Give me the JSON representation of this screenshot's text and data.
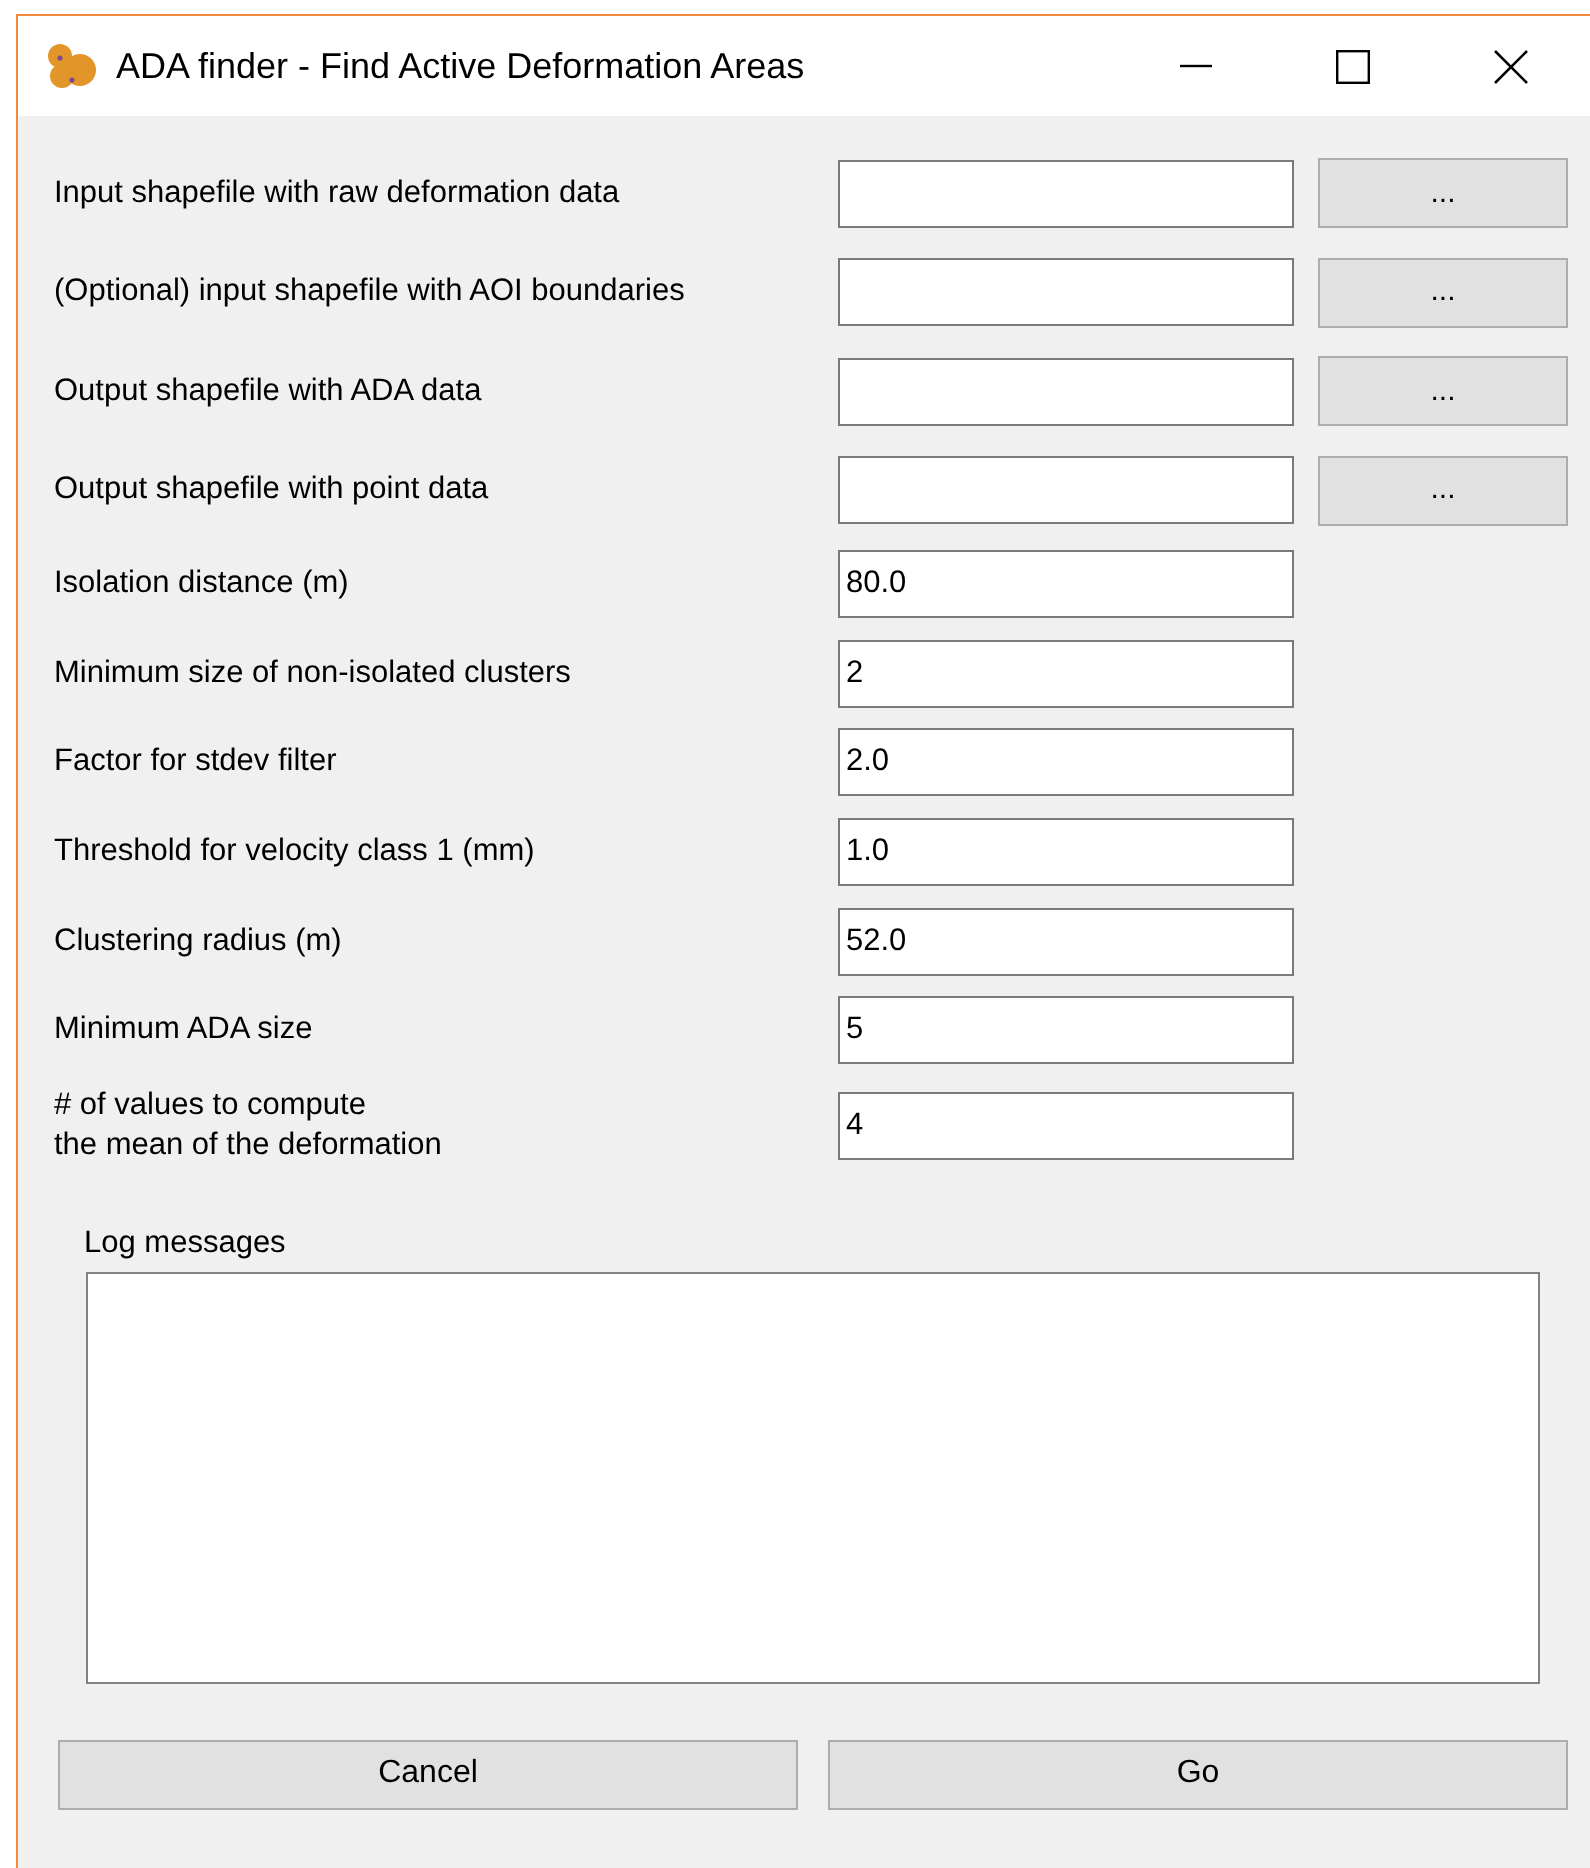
{
  "window": {
    "title": "ADA finder - Find Active Deformation Areas"
  },
  "fields": [
    {
      "kind": "file",
      "label": "Input shapefile with raw deformation data",
      "button": "..."
    },
    {
      "kind": "file",
      "label": "(Optional) input shapefile with AOI boundaries",
      "button": "..."
    },
    {
      "kind": "file",
      "label": "Output shapefile with ADA data",
      "button": "..."
    },
    {
      "kind": "file",
      "label": "Output shapefile with point data",
      "button": "..."
    },
    {
      "kind": "number",
      "label": "Isolation distance (m)",
      "value": "80.0"
    },
    {
      "kind": "number",
      "label": "Minimum size of non-isolated clusters",
      "value": "2"
    },
    {
      "kind": "number",
      "label": "Factor for stdev filter",
      "value": "2.0"
    },
    {
      "kind": "number",
      "label": "Threshold for velocity class 1 (mm)",
      "value": "1.0"
    },
    {
      "kind": "number",
      "label": "Clustering radius (m)",
      "value": "52.0"
    },
    {
      "kind": "number",
      "label": "Minimum ADA size",
      "value": "5"
    },
    {
      "kind": "number",
      "label": "# of values to compute\nthe mean of the deformation",
      "value": "4"
    }
  ],
  "log": {
    "label": "Log messages"
  },
  "buttons": [
    "Cancel",
    "Go"
  ]
}
